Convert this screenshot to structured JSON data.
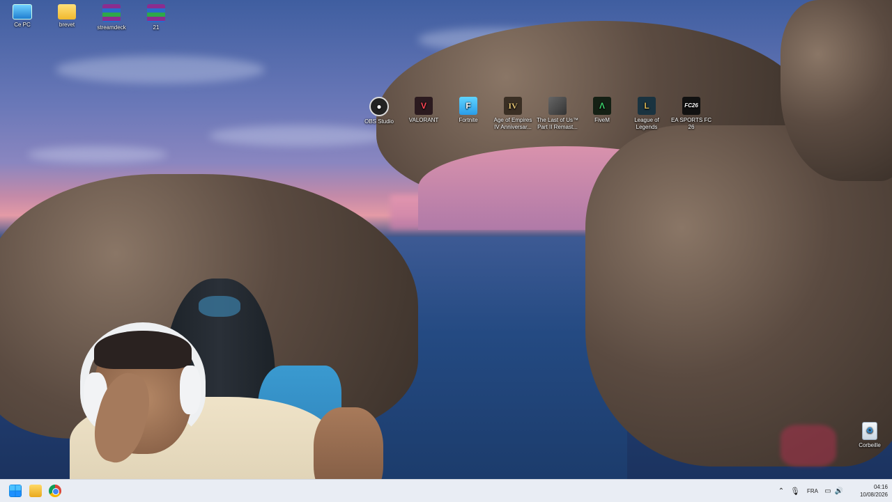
{
  "desktop_icons": [
    {
      "label": "Ce PC",
      "icon": "pc-icon",
      "color": "#3aa0e0"
    },
    {
      "label": "brevet",
      "icon": "folder-icon",
      "color": "#f3c640"
    },
    {
      "label": "streamdeck",
      "icon": "winrar-icon",
      "color": "#8b2d8f"
    },
    {
      "label": "21",
      "icon": "winrar-icon",
      "color": "#8b2d8f"
    }
  ],
  "app_icons": [
    {
      "label": "OBS Studio",
      "icon": "obs-icon",
      "glyph": "●",
      "color": "#1b1b1b"
    },
    {
      "label": "VALORANT",
      "icon": "valorant-icon",
      "glyph": "V",
      "color": "#2b1a1f"
    },
    {
      "label": "Fortnite",
      "icon": "fortnite-icon",
      "glyph": "F",
      "color": "#3ab5f5"
    },
    {
      "label": "Age of Empires IV Anniversar...",
      "icon": "aoe-icon",
      "glyph": "IV",
      "color": "#3a2f24"
    },
    {
      "label": "The Last of Us™ Part II Remast...",
      "icon": "tlou-icon",
      "glyph": "",
      "color": "#555a55"
    },
    {
      "label": "FiveM",
      "icon": "fivem-icon",
      "glyph": "Λ",
      "color": "#1a2a1a"
    },
    {
      "label": "League of Legends",
      "icon": "lol-icon",
      "glyph": "L",
      "color": "#1a3340"
    },
    {
      "label": "EA SPORTS FC 26",
      "icon": "fc26-icon",
      "glyph": "FC26",
      "color": "#111111"
    }
  ],
  "recycle_bin": {
    "label": "Corbeille"
  },
  "taskbar": {
    "lang": "FRA",
    "time": "04:16",
    "date": "10/08/2026"
  }
}
